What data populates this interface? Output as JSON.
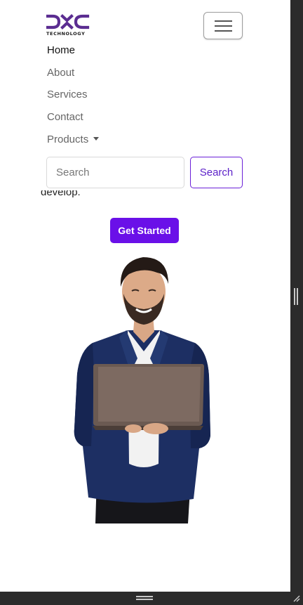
{
  "brand": {
    "logo_text": "DXC",
    "caption": "TECHNOLOGY",
    "color": "#5b2d91"
  },
  "navbar": {
    "toggler_icon": "hamburger-icon",
    "items": [
      {
        "label": "Home",
        "active": true
      },
      {
        "label": "About",
        "active": false
      },
      {
        "label": "Services",
        "active": false
      },
      {
        "label": "Contact",
        "active": false
      },
      {
        "label": "Products",
        "active": false,
        "dropdown": true
      }
    ]
  },
  "search": {
    "placeholder": "Search",
    "button_label": "Search",
    "accent": "#6a1fd8"
  },
  "hero": {
    "text_fragment": "develop.",
    "cta_label": "Get Started",
    "cta_color": "#6a10e8",
    "image_icon": "man-with-laptop-image"
  }
}
